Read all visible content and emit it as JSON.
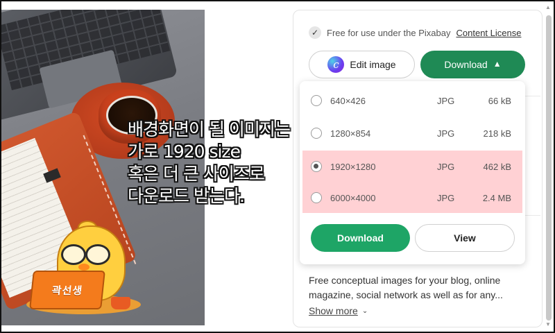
{
  "overlay": {
    "lines": [
      "배경화면이 될 이미지는",
      "가로 1920 size",
      "혹은 더 큰 사이즈로",
      "다운로드 받는다."
    ]
  },
  "mascot": {
    "label": "곽선생"
  },
  "panel": {
    "license_text": "Free for use under the Pixabay",
    "license_link": "Content License",
    "edit_button": "Edit image",
    "download_button": "Download",
    "options": [
      {
        "dimensions": "640×426",
        "format": "JPG",
        "size": "66 kB",
        "selected": false,
        "highlighted": false
      },
      {
        "dimensions": "1280×854",
        "format": "JPG",
        "size": "218 kB",
        "selected": false,
        "highlighted": false
      },
      {
        "dimensions": "1920×1280",
        "format": "JPG",
        "size": "462 kB",
        "selected": true,
        "highlighted": true
      },
      {
        "dimensions": "6000×4000",
        "format": "JPG",
        "size": "2.4 MB",
        "selected": false,
        "highlighted": true
      }
    ],
    "dropdown_download": "Download",
    "dropdown_view": "View",
    "description": "Free conceptual images for your blog, online magazine, social network as well as for any...",
    "show_more": "Show more"
  },
  "icons": {
    "check": "check-icon",
    "canva": "canva-icon",
    "chevron_up": "chevron-up-icon",
    "chevron_down": "chevron-down-icon"
  },
  "colors": {
    "download_dark": "#1f8a55",
    "download_green": "#1ea566",
    "highlight": "#ffd1d4"
  }
}
